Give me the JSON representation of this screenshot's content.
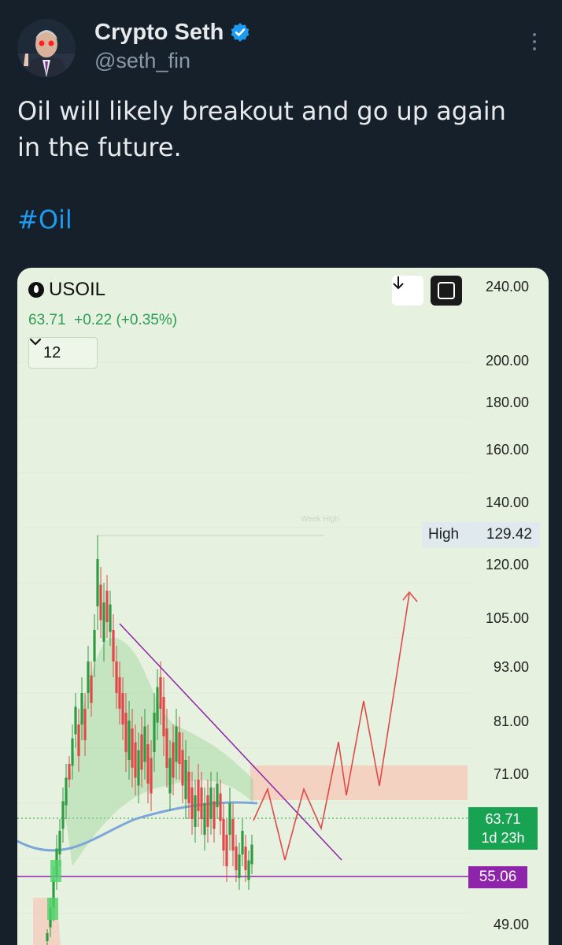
{
  "tweet": {
    "author_name": "Crypto Seth",
    "author_handle": "@seth_fin",
    "verified": true,
    "text_line1": "Oil will likely breakout and go up again",
    "text_line2": "in the future.",
    "hashtag": "#Oil",
    "accent_color": "#1d9bf0"
  },
  "chart_header": {
    "symbol": "USOIL",
    "quote_price": "63.71",
    "quote_change": "+0.22",
    "quote_change_pct": "(+0.35%)",
    "interval": "12",
    "download_icon": "download-arrow-icon",
    "fullscreen_icon": "fullscreen-icon"
  },
  "chart_data": {
    "type": "line",
    "symbol": "USOIL",
    "y_axis_ticks": [
      240.0,
      200.0,
      180.0,
      160.0,
      140.0,
      120.0,
      105.0,
      93.0,
      81.0,
      71.0,
      49.0
    ],
    "y_tick_labels": [
      "240.00",
      "200.00",
      "180.00",
      "160.00",
      "140.00",
      "120.00",
      "105.00",
      "93.00",
      "81.00",
      "71.00",
      "49.00"
    ],
    "high_label": "High",
    "high_value": "129.42",
    "current_price_label": "63.71",
    "countdown_label": "1d 23h",
    "support_label": "55.06",
    "annotation": "Week High",
    "colors": {
      "up": "#2e9c42",
      "down": "#e0484a",
      "trend": "#8e24aa",
      "support": "#8e24aa",
      "projection": "#e0484a",
      "zone": "#f7c7b8",
      "ma": "#7da7d9"
    }
  }
}
